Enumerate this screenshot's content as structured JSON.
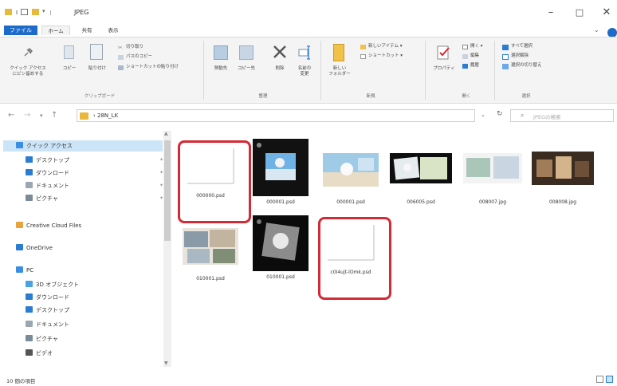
{
  "window": {
    "title": "JPEG",
    "minimize_glyph": "–",
    "maximize_glyph": "□",
    "close_glyph": "✕"
  },
  "ribbon_tabs": {
    "file": "ファイル",
    "home": "ホーム",
    "share": "共有",
    "view": "表示"
  },
  "ribbon": {
    "clipboard": {
      "pin_label": "クイック アクセス\nにピン留めする",
      "copy_label": "コピー",
      "paste_label": "貼り付け",
      "cut_label": "切り取り",
      "copy_path_label": "パスのコピー",
      "paste_shortcut_label": "ショートカットの貼り付け",
      "group_label": "クリップボード"
    },
    "organize": {
      "move_to_label": "移動先",
      "copy_to_label": "コピー先",
      "delete_label": "削除",
      "rename_label": "名前の\n変更",
      "group_label": "整理"
    },
    "new": {
      "new_folder_label": "新しい\nフォルダー",
      "new_item_label": "新しいアイテム ▾",
      "easy_access_label": "ショートカット ▾",
      "group_label": "新規"
    },
    "open": {
      "properties_label": "プロパティ",
      "open_label": "開く ▾",
      "edit_label": "編集",
      "history_label": "履歴",
      "group_label": "開く"
    },
    "select": {
      "select_all_label": "すべて選択",
      "select_none_label": "選択解除",
      "invert_label": "選択の切り替え",
      "group_label": "選択"
    }
  },
  "address": {
    "back": "←",
    "forward": "→",
    "recent": "▾",
    "up": "↑",
    "path": "› 28N_LK",
    "dropdown": "⌄",
    "refresh": "↻",
    "search_icon": "⌕",
    "search_placeholder": "JPEGの検索"
  },
  "nav": {
    "items": [
      {
        "label": "クイック アクセス",
        "icon": "star-icon",
        "color": "#3a8ee6",
        "selected": true
      },
      {
        "label": "デスクトップ",
        "icon": "desktop-icon",
        "color": "#2b7cd3",
        "pinned": true
      },
      {
        "label": "ダウンロード",
        "icon": "download-icon",
        "color": "#2b7cd3",
        "pinned": true
      },
      {
        "label": "ドキュメント",
        "icon": "document-icon",
        "color": "#9aa7b3",
        "pinned": true
      },
      {
        "label": "ピクチャ",
        "icon": "pictures-icon",
        "color": "#7a8a99",
        "pinned": true
      },
      {
        "label": "Creative Cloud Files",
        "icon": "creative-cloud-icon",
        "color": "#e8a33a"
      },
      {
        "label": "OneDrive",
        "icon": "onedrive-icon",
        "color": "#2b7cd3"
      },
      {
        "label": "PC",
        "icon": "pc-icon",
        "color": "#3a8ee6"
      },
      {
        "label": "3D オブジェクト",
        "icon": "3d-objects-icon",
        "color": "#4aa3e0"
      },
      {
        "label": "ダウンロード",
        "icon": "download-icon",
        "color": "#2b7cd3"
      },
      {
        "label": "デスクトップ",
        "icon": "desktop-icon",
        "color": "#2b7cd3"
      },
      {
        "label": "ドキュメント",
        "icon": "document-icon",
        "color": "#9aa7b3"
      },
      {
        "label": "ピクチャ",
        "icon": "pictures-icon",
        "color": "#7a8a99"
      },
      {
        "label": "ビデオ",
        "icon": "video-icon",
        "color": "#555555"
      }
    ]
  },
  "files": [
    {
      "name": "000000.psd",
      "kind": "blank",
      "highlighted": true
    },
    {
      "name": "000001.psd",
      "kind": "photo-dark"
    },
    {
      "name": "000001.psd",
      "kind": "photo-beach"
    },
    {
      "name": "006005.psd",
      "kind": "photo-wide"
    },
    {
      "name": "008007.jpg",
      "kind": "photo-light"
    },
    {
      "name": "008008.jpg",
      "kind": "photo-room"
    },
    {
      "name": "010001.psd",
      "kind": "photo-collage"
    },
    {
      "name": "010001.psd",
      "kind": "photo-bw"
    },
    {
      "name": "c0I4ujt-lOmk.psd",
      "kind": "blank",
      "highlighted": true
    }
  ],
  "status": {
    "item_count": "10 個の項目"
  },
  "colors": {
    "accent": "#1c6ac9",
    "highlight_border": "#d42a36",
    "selection": "#cce4f7",
    "folder": "#e8b93b"
  }
}
